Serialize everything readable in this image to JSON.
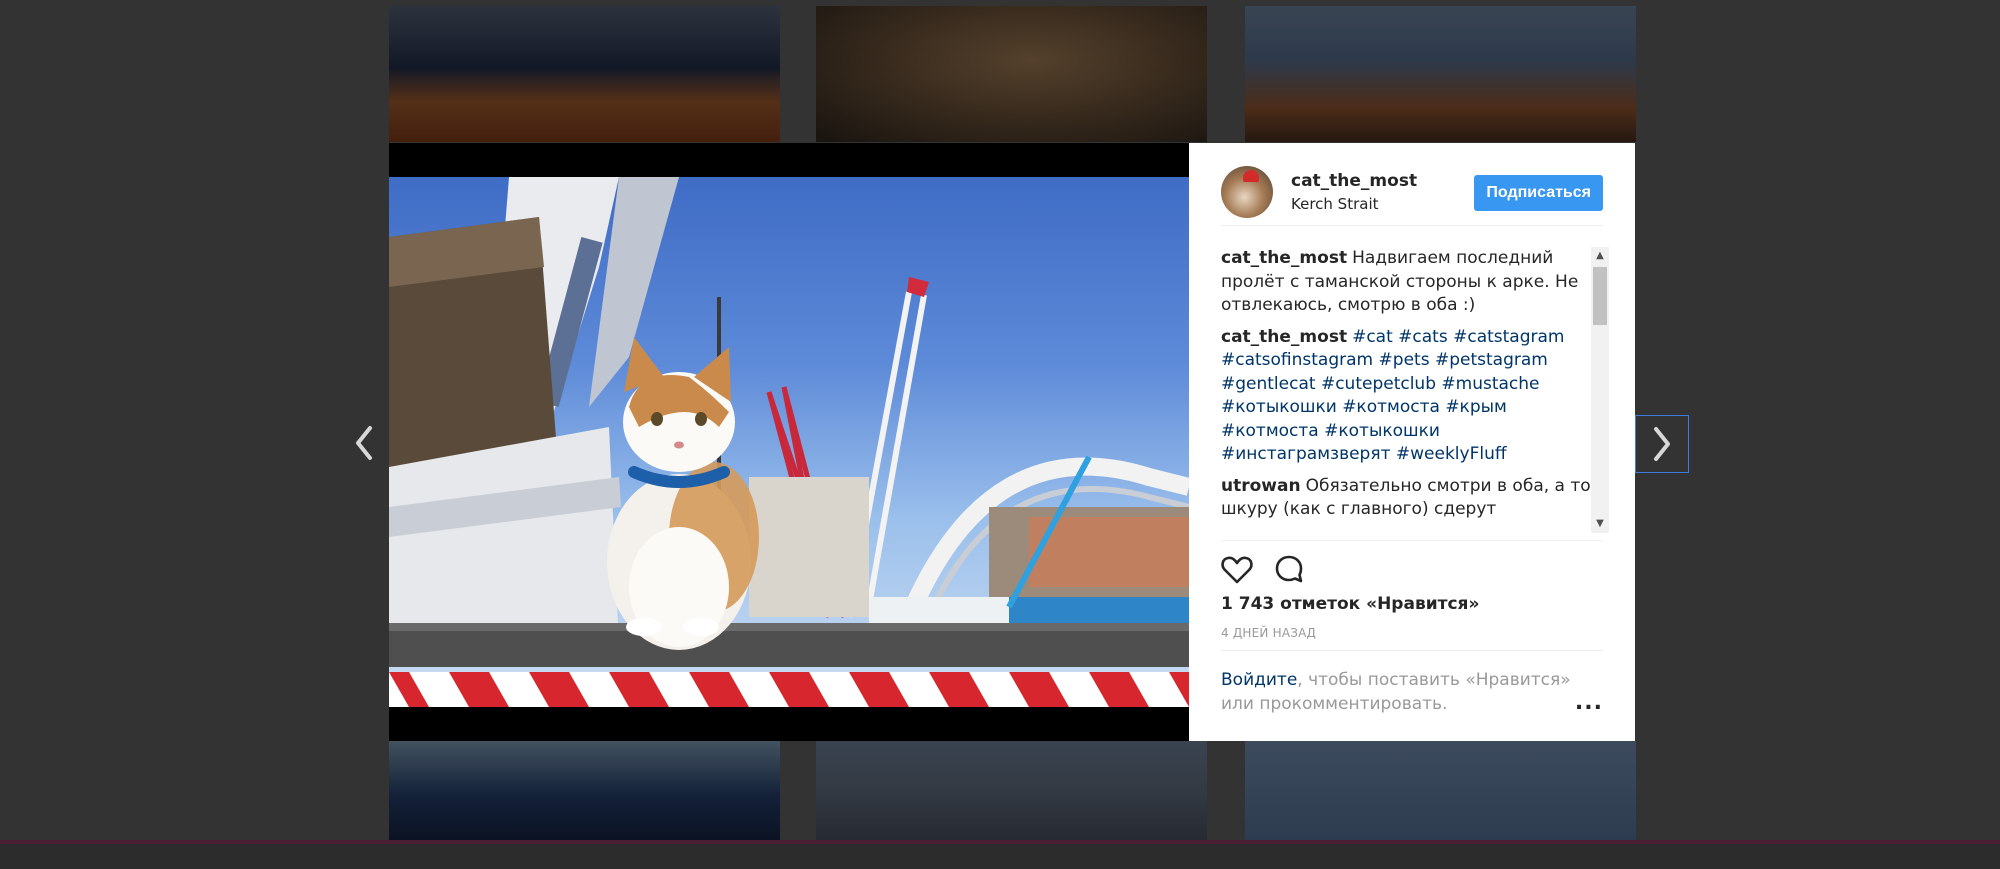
{
  "post": {
    "username": "cat_the_most",
    "location": "Kerch Strait",
    "follow_label": "Подписаться",
    "likes": "1 743 отметок «Нравится»",
    "date": "4 ДНЕЙ НАЗАД",
    "login_link": "Войдите",
    "login_rest": ", чтобы поставить «Нравится» или прокомментировать.",
    "more_label": "..."
  },
  "comments": [
    {
      "user": "cat_the_most",
      "parts": [
        {
          "text": "Надвигаем последний пролёт с таманской стороны к арке. Не отвлекаюсь, смотрю в оба :)",
          "tag": false
        }
      ]
    },
    {
      "user": "cat_the_most",
      "parts": [
        {
          "text": "#cat",
          "tag": true
        },
        {
          "text": " ",
          "tag": false
        },
        {
          "text": "#cats",
          "tag": true
        },
        {
          "text": " ",
          "tag": false
        },
        {
          "text": "#catstagram",
          "tag": true
        },
        {
          "text": " ",
          "tag": false
        },
        {
          "text": "#catsofinstagram",
          "tag": true
        },
        {
          "text": " ",
          "tag": false
        },
        {
          "text": "#pets",
          "tag": true
        },
        {
          "text": " ",
          "tag": false
        },
        {
          "text": "#petstagram",
          "tag": true
        },
        {
          "text": " ",
          "tag": false
        },
        {
          "text": "#gentlecat",
          "tag": true
        },
        {
          "text": " ",
          "tag": false
        },
        {
          "text": "#cutepetclub",
          "tag": true
        },
        {
          "text": " ",
          "tag": false
        },
        {
          "text": "#mustache",
          "tag": true
        },
        {
          "text": " ",
          "tag": false
        },
        {
          "text": "#котыкошки",
          "tag": true
        },
        {
          "text": " ",
          "tag": false
        },
        {
          "text": "#котмоста",
          "tag": true
        },
        {
          "text": " ",
          "tag": false
        },
        {
          "text": "#крым",
          "tag": true
        },
        {
          "text": " ",
          "tag": false
        },
        {
          "text": "#котмоста",
          "tag": true
        },
        {
          "text": " ",
          "tag": false
        },
        {
          "text": "#котыкошки",
          "tag": true
        },
        {
          "text": " ",
          "tag": false
        },
        {
          "text": "#инстаграмзверят",
          "tag": true
        },
        {
          "text": " ",
          "tag": false
        },
        {
          "text": "#weeklyFluff",
          "tag": true
        }
      ]
    },
    {
      "user": "utrowan",
      "parts": [
        {
          "text": "Обязательно смотри в оба, а то шкуру (как с главного) сдерут",
          "tag": false
        }
      ]
    }
  ],
  "icons": {
    "like": "heart-icon",
    "comment": "comment-bubble-icon",
    "prev": "chevron-left-icon",
    "next": "chevron-right-icon"
  },
  "colors": {
    "follow_button": "#3897f0",
    "link": "#003569",
    "overlay": "#333333"
  }
}
